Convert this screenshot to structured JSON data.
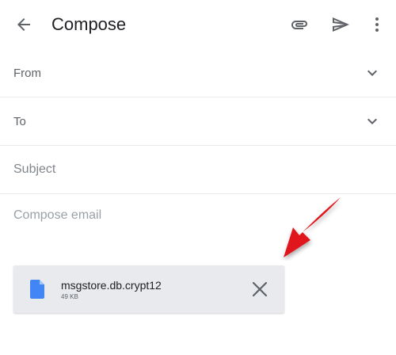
{
  "appbar": {
    "title": "Compose",
    "back_icon": "arrow-back-icon",
    "attach_icon": "paperclip-icon",
    "send_icon": "send-icon",
    "more_icon": "more-vert-icon"
  },
  "form": {
    "from_label": "From",
    "to_label": "To",
    "subject_placeholder": "Subject",
    "body_placeholder": "Compose email"
  },
  "attachment": {
    "filename": "msgstore.db.crypt12",
    "size": "49 KB",
    "file_icon": "document-icon",
    "remove_icon": "close-icon"
  },
  "colors": {
    "text_primary": "#202124",
    "text_secondary": "#5f6368",
    "placeholder": "#9aa0a6",
    "divider": "#e8eaed",
    "chip_background": "#e8eaed",
    "file_icon_blue": "#4285f4",
    "annotation_red": "#e0141e"
  }
}
